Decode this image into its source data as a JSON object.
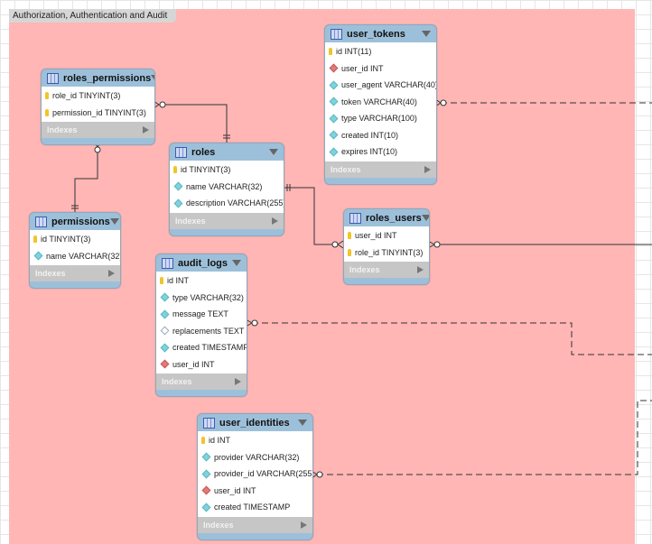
{
  "layer": {
    "title": "Authorization, Authentication and Audit",
    "color": "#ffb6b4"
  },
  "indexes_label": "Indexes",
  "tables": {
    "roles_permissions": {
      "name": "roles_permissions",
      "columns": [
        {
          "label": "role_id TINYINT(3)",
          "kind": "key"
        },
        {
          "label": "permission_id TINYINT(3)",
          "kind": "key"
        }
      ]
    },
    "roles": {
      "name": "roles",
      "columns": [
        {
          "label": "id TINYINT(3)",
          "kind": "key"
        },
        {
          "label": "name VARCHAR(32)",
          "kind": "col"
        },
        {
          "label": "description VARCHAR(255)",
          "kind": "col"
        }
      ]
    },
    "permissions": {
      "name": "permissions",
      "columns": [
        {
          "label": "id TINYINT(3)",
          "kind": "key"
        },
        {
          "label": "name VARCHAR(32)",
          "kind": "col"
        }
      ]
    },
    "user_tokens": {
      "name": "user_tokens",
      "columns": [
        {
          "label": "id INT(11)",
          "kind": "key"
        },
        {
          "label": "user_id INT",
          "kind": "fk"
        },
        {
          "label": "user_agent VARCHAR(40)",
          "kind": "col"
        },
        {
          "label": "token VARCHAR(40)",
          "kind": "col"
        },
        {
          "label": "type VARCHAR(100)",
          "kind": "col"
        },
        {
          "label": "created INT(10)",
          "kind": "col"
        },
        {
          "label": "expires INT(10)",
          "kind": "col"
        }
      ]
    },
    "roles_users": {
      "name": "roles_users",
      "columns": [
        {
          "label": "user_id INT",
          "kind": "key"
        },
        {
          "label": "role_id TINYINT(3)",
          "kind": "key"
        }
      ]
    },
    "audit_logs": {
      "name": "audit_logs",
      "columns": [
        {
          "label": "id INT",
          "kind": "key"
        },
        {
          "label": "type VARCHAR(32)",
          "kind": "col"
        },
        {
          "label": "message TEXT",
          "kind": "col"
        },
        {
          "label": "replacements TEXT",
          "kind": "null"
        },
        {
          "label": "created TIMESTAMP",
          "kind": "col"
        },
        {
          "label": "user_id INT",
          "kind": "fk"
        }
      ]
    },
    "user_identities": {
      "name": "user_identities",
      "columns": [
        {
          "label": "id INT",
          "kind": "key"
        },
        {
          "label": "provider VARCHAR(32)",
          "kind": "col"
        },
        {
          "label": "provider_id VARCHAR(255)",
          "kind": "col"
        },
        {
          "label": "user_id INT",
          "kind": "fk"
        },
        {
          "label": "created TIMESTAMP",
          "kind": "col"
        }
      ]
    }
  }
}
